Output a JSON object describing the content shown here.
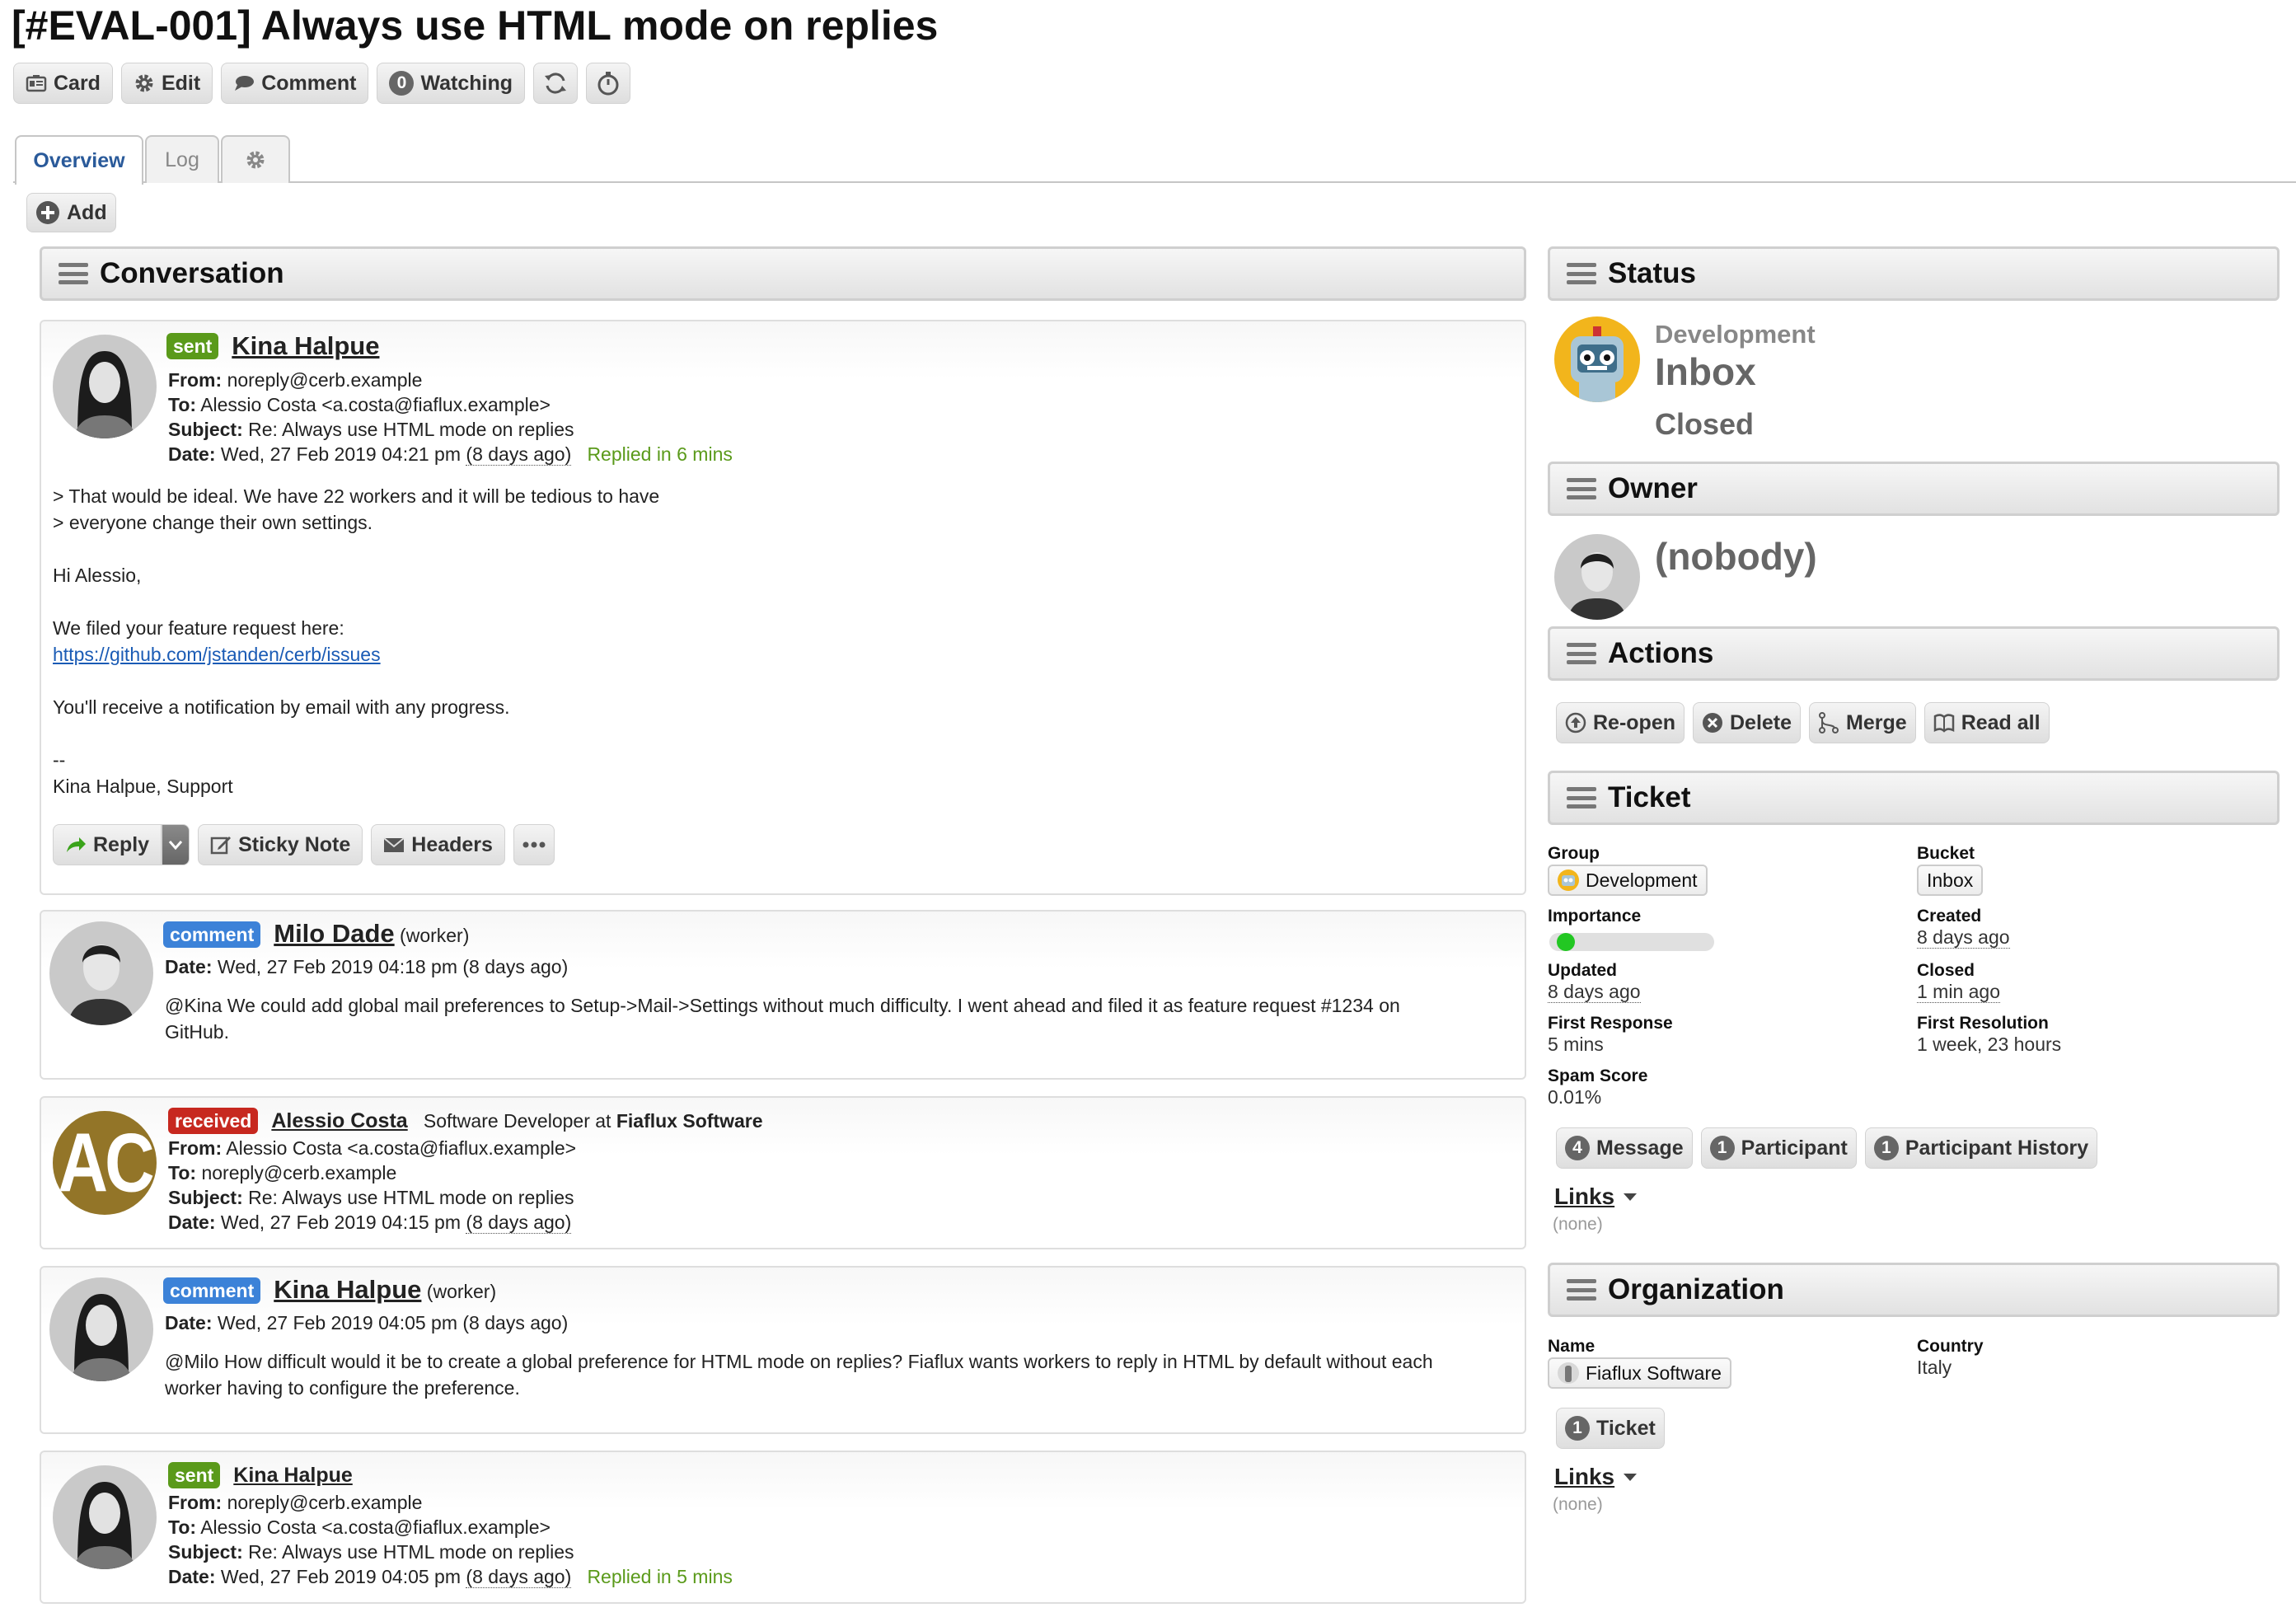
{
  "title": "[#EVAL-001] Always use HTML mode on replies",
  "toolbar": {
    "card": "Card",
    "edit": "Edit",
    "comment": "Comment",
    "watching_count": "0",
    "watching": "Watching"
  },
  "tabs": {
    "overview": "Overview",
    "log": "Log"
  },
  "add_label": "Add",
  "conversation": {
    "heading": "Conversation",
    "messages": [
      {
        "badge": "sent",
        "name": "Kina Halpue",
        "from_label": "From:",
        "from": "noreply@cerb.example",
        "to_label": "To:",
        "to": "Alessio Costa <a.costa@fiaflux.example>",
        "subject_label": "Subject:",
        "subject": "Re: Always use HTML mode on replies",
        "date_label": "Date:",
        "date": "Wed, 27 Feb 2019 04:21 pm",
        "ago": "(8 days ago)",
        "replied": "Replied in 6 mins",
        "body": [
          "> That would be ideal. We have 22 workers and it will be tedious to have",
          "> everyone change their own settings.",
          "Hi Alessio,",
          "We filed your feature request here:",
          "https://github.com/jstanden/cerb/issues",
          "You'll receive a notification by email with any progress.",
          "--",
          "Kina Halpue, Support"
        ],
        "actions": {
          "reply": "Reply",
          "sticky": "Sticky Note",
          "headers": "Headers"
        }
      },
      {
        "badge": "comment",
        "name": "Milo Dade",
        "role": "(worker)",
        "date_label": "Date:",
        "date": "Wed, 27 Feb 2019 04:18 pm (8 days ago)",
        "body": [
          "@Kina We could add global mail preferences to Setup->Mail->Settings without much difficulty. I went ahead and filed it as feature request #1234 on",
          "GitHub."
        ]
      },
      {
        "badge": "received",
        "name": "Alessio Costa",
        "title_text": "Software Developer at",
        "org": "Fiaflux Software",
        "initials": "AC",
        "from_label": "From:",
        "from": "Alessio Costa <a.costa@fiaflux.example>",
        "to_label": "To:",
        "to": "noreply@cerb.example",
        "subject_label": "Subject:",
        "subject": "Re: Always use HTML mode on replies",
        "date_label": "Date:",
        "date": "Wed, 27 Feb 2019 04:15 pm",
        "ago": "(8 days ago)"
      },
      {
        "badge": "comment",
        "name": "Kina Halpue",
        "role": "(worker)",
        "date_label": "Date:",
        "date": "Wed, 27 Feb 2019 04:05 pm (8 days ago)",
        "body": [
          "@Milo How difficult would it be to create a global preference for HTML mode on replies? Fiaflux wants workers to reply in HTML by default without each",
          "worker having to configure the preference."
        ]
      },
      {
        "badge": "sent",
        "name": "Kina Halpue",
        "from_label": "From:",
        "from": "noreply@cerb.example",
        "to_label": "To:",
        "to": "Alessio Costa <a.costa@fiaflux.example>",
        "subject_label": "Subject:",
        "subject": "Re: Always use HTML mode on replies",
        "date_label": "Date:",
        "date": "Wed, 27 Feb 2019 04:05 pm",
        "ago": "(8 days ago)",
        "replied": "Replied in 5 mins"
      }
    ]
  },
  "status": {
    "heading": "Status",
    "group": "Development",
    "bucket": "Inbox",
    "state": "Closed"
  },
  "owner": {
    "heading": "Owner",
    "name": "(nobody)"
  },
  "actions": {
    "heading": "Actions",
    "reopen": "Re-open",
    "delete": "Delete",
    "merge": "Merge",
    "readall": "Read all"
  },
  "ticket": {
    "heading": "Ticket",
    "group_label": "Group",
    "group": "Development",
    "bucket_label": "Bucket",
    "bucket": "Inbox",
    "importance_label": "Importance",
    "importance": 0.05,
    "created_label": "Created",
    "created": "8 days ago",
    "updated_label": "Updated",
    "updated": "8 days ago",
    "closed_label": "Closed",
    "closed": "1 min ago",
    "first_response_label": "First Response",
    "first_response": "5 mins",
    "first_resolution_label": "First Resolution",
    "first_resolution": "1 week, 23 hours",
    "spam_label": "Spam Score",
    "spam": "0.01%",
    "counts": [
      {
        "n": "4",
        "label": "Message"
      },
      {
        "n": "1",
        "label": "Participant"
      },
      {
        "n": "1",
        "label": "Participant History"
      }
    ],
    "links": "Links",
    "links_none": "(none)"
  },
  "organization": {
    "heading": "Organization",
    "name_label": "Name",
    "name": "Fiaflux Software",
    "country_label": "Country",
    "country": "Italy",
    "ticket_n": "1",
    "ticket": "Ticket",
    "links": "Links",
    "links_none": "(none)"
  },
  "colors": {
    "sent": "#5a9a1a",
    "comment": "#3c82d8",
    "received": "#c7281f",
    "link": "#1a5bb5",
    "accent": "#2a5a9a",
    "importance": "#22c722"
  }
}
